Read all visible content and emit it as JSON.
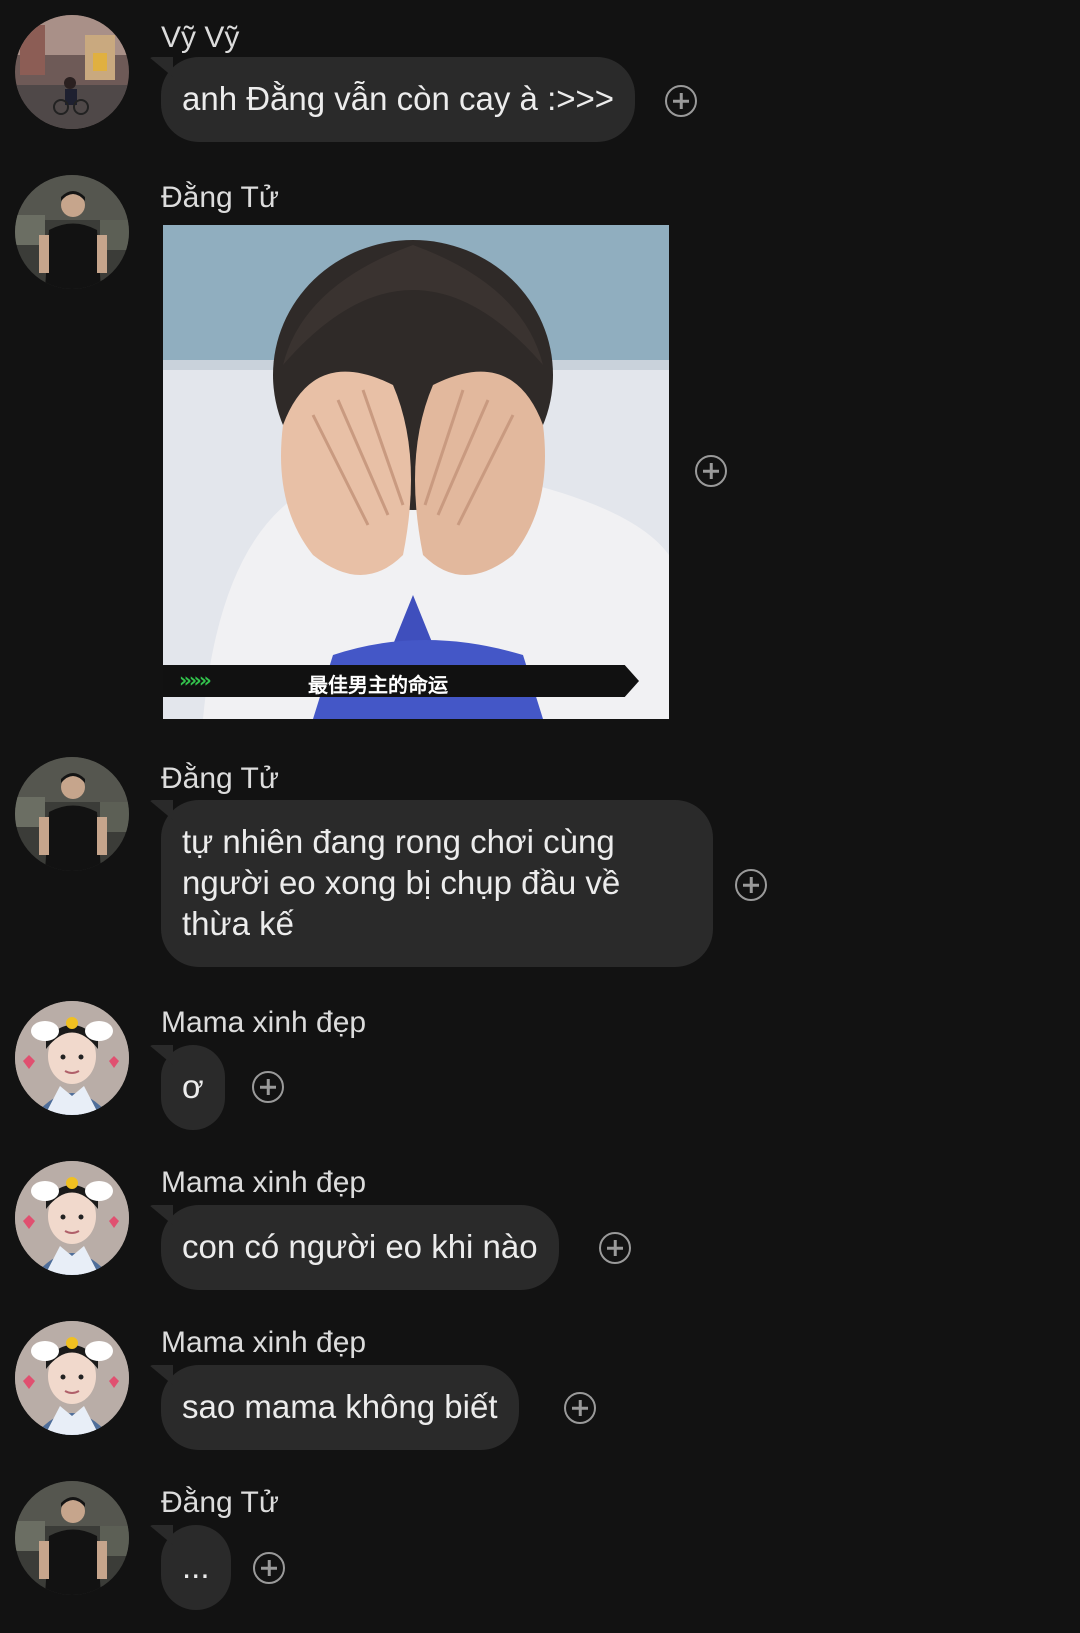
{
  "messages": [
    {
      "sender": "Vỹ Vỹ",
      "type": "text",
      "text": "anh Đằng vẫn còn cay à :>>>",
      "avatar": "avatar-vyvy"
    },
    {
      "sender": "Đằng Tử",
      "type": "image",
      "caption": "最佳男主的命运",
      "image_icon": "meme-image",
      "avatar": "avatar-dangtu"
    },
    {
      "sender": "Đằng Tử",
      "type": "text",
      "text": "tự nhiên đang rong chơi cùng người eo xong bị chụp đầu về thừa kế",
      "avatar": "avatar-dangtu"
    },
    {
      "sender": "Mama xinh đẹp",
      "type": "text",
      "text": "ơ",
      "avatar": "avatar-mama"
    },
    {
      "sender": "Mama xinh đẹp",
      "type": "text",
      "text": "con có người eo khi nào",
      "avatar": "avatar-mama"
    },
    {
      "sender": "Mama xinh đẹp",
      "type": "text",
      "text": "sao mama không biết",
      "avatar": "avatar-mama"
    },
    {
      "sender": "Đằng Tử",
      "type": "text",
      "text": "...",
      "avatar": "avatar-dangtu"
    }
  ],
  "icons": {
    "react": "add-reaction-icon",
    "caption_arrows": "»»»"
  },
  "colors": {
    "background": "#121212",
    "bubble": "#2a2a2a",
    "text": "#ececec"
  }
}
